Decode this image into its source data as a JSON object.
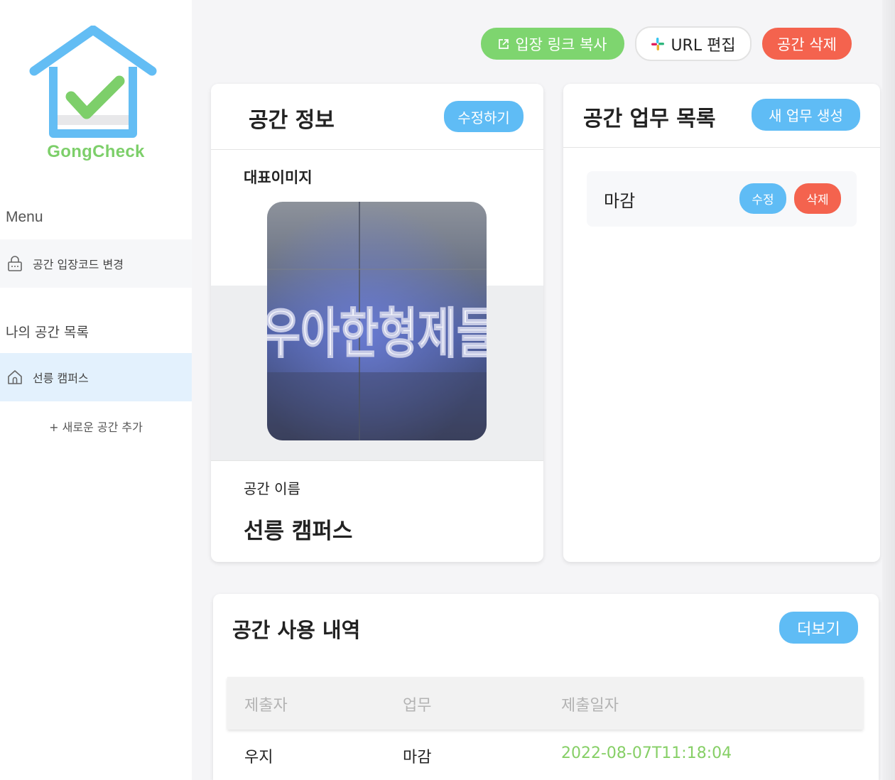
{
  "brand": {
    "name": "GongCheck"
  },
  "sidebar": {
    "menu_title": "Menu",
    "change_code_label": "공간 입장코드 변경",
    "spaces_title": "나의 공간 목록",
    "spaces": [
      {
        "label": "선릉 캠퍼스"
      }
    ],
    "add_space_label": "+ 새로운 공간 추가"
  },
  "toolbar": {
    "copy_link_label": "입장 링크 복사",
    "edit_url_label": "URL 편집",
    "delete_space_label": "공간 삭제"
  },
  "space_info": {
    "title": "공간 정보",
    "edit_label": "수정하기",
    "image_label": "대표이미지",
    "image_sign_text": "우아한형제들",
    "name_label": "공간 이름",
    "name_value": "선릉 캠퍼스"
  },
  "tasks": {
    "title": "공간 업무 목록",
    "new_task_label": "새 업무 생성",
    "items": [
      {
        "name": "마감",
        "edit_label": "수정",
        "delete_label": "삭제"
      }
    ]
  },
  "usage": {
    "title": "공간 사용 내역",
    "more_label": "더보기",
    "columns": [
      "제출자",
      "업무",
      "제출일자"
    ],
    "rows": [
      {
        "submitter": "우지",
        "task": "마감",
        "date": "2022-08-07T11:18:04"
      }
    ]
  },
  "colors": {
    "primary_blue": "#5fbcf5",
    "green": "#7ed56f",
    "red": "#f4634e",
    "date_green": "#86cf66",
    "selected_bg": "#e3f1fd"
  },
  "icons": [
    "house-check-logo",
    "lock-icon",
    "home-icon",
    "external-link-icon",
    "slack-icon"
  ]
}
